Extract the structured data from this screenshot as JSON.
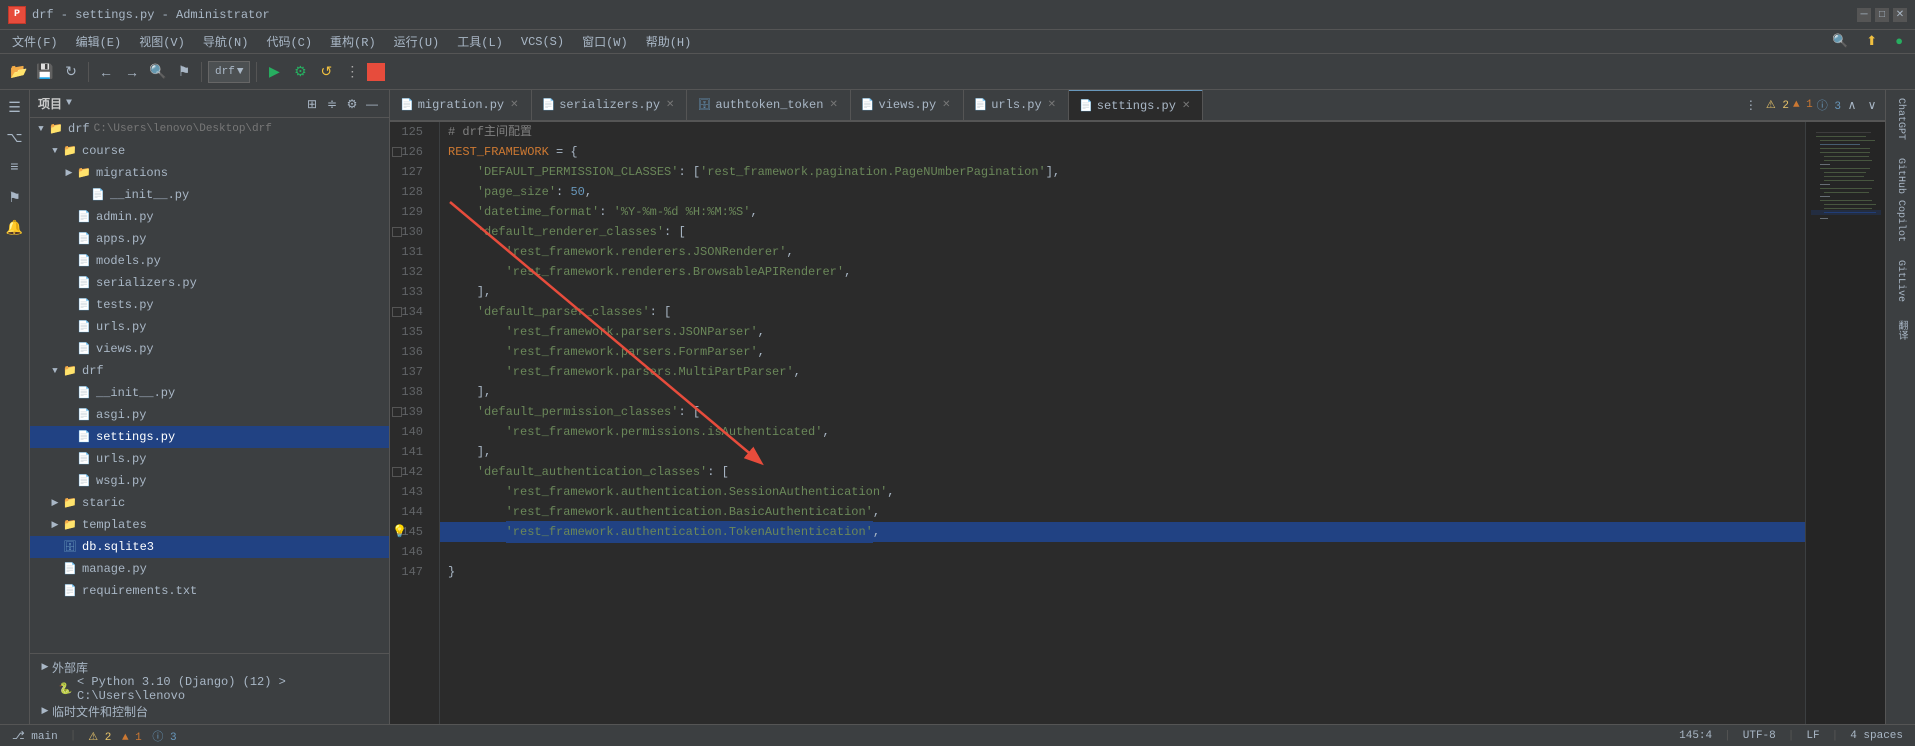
{
  "titlebar": {
    "title": "drf - settings.py - Administrator",
    "logo": "P"
  },
  "menubar": {
    "items": [
      "文件(F)",
      "编辑(E)",
      "视图(V)",
      "导航(N)",
      "代码(C)",
      "重构(R)",
      "运行(U)",
      "工具(L)",
      "VCS(S)",
      "窗口(W)",
      "帮助(H)"
    ]
  },
  "toolbar": {
    "project_name": "drf",
    "run_stop_label": "■"
  },
  "tabs": [
    {
      "label": "migration.py",
      "icon": "📄",
      "active": false
    },
    {
      "label": "serializers.py",
      "icon": "📄",
      "active": false
    },
    {
      "label": "authtoken_token",
      "icon": "🗄",
      "active": false
    },
    {
      "label": "views.py",
      "icon": "📄",
      "active": false
    },
    {
      "label": "urls.py",
      "icon": "📄",
      "active": false
    },
    {
      "label": "settings.py",
      "icon": "📄",
      "active": true
    }
  ],
  "filetree": {
    "project_name": "drf",
    "project_path": "C:\\Users\\lenovo\\Desktop\\drf",
    "items": [
      {
        "id": "drf-root",
        "label": "drf",
        "type": "folder",
        "level": 0,
        "expanded": true,
        "path": "C:\\Users\\lenovo\\Desktop\\drf"
      },
      {
        "id": "course",
        "label": "course",
        "type": "folder",
        "level": 1,
        "expanded": true
      },
      {
        "id": "migrations",
        "label": "migrations",
        "type": "folder",
        "level": 2,
        "expanded": false
      },
      {
        "id": "init1",
        "label": "__init__.py",
        "type": "py",
        "level": 3
      },
      {
        "id": "admin",
        "label": "admin.py",
        "type": "py",
        "level": 2
      },
      {
        "id": "apps",
        "label": "apps.py",
        "type": "py",
        "level": 2
      },
      {
        "id": "models",
        "label": "models.py",
        "type": "py",
        "level": 2
      },
      {
        "id": "serializers",
        "label": "serializers.py",
        "type": "py",
        "level": 2
      },
      {
        "id": "tests",
        "label": "tests.py",
        "type": "py",
        "level": 2
      },
      {
        "id": "urls-course",
        "label": "urls.py",
        "type": "py",
        "level": 2
      },
      {
        "id": "views-course",
        "label": "views.py",
        "type": "py",
        "level": 2
      },
      {
        "id": "drf-inner",
        "label": "drf",
        "type": "folder",
        "level": 1,
        "expanded": true
      },
      {
        "id": "init2",
        "label": "__init__.py",
        "type": "py",
        "level": 2
      },
      {
        "id": "asgi",
        "label": "asgi.py",
        "type": "py",
        "level": 2
      },
      {
        "id": "settings",
        "label": "settings.py",
        "type": "py",
        "level": 2,
        "selected": true
      },
      {
        "id": "urls-drf",
        "label": "urls.py",
        "type": "py",
        "level": 2
      },
      {
        "id": "wsgi",
        "label": "wsgi.py",
        "type": "py",
        "level": 2
      },
      {
        "id": "staric",
        "label": "staric",
        "type": "folder",
        "level": 1,
        "expanded": false
      },
      {
        "id": "templates",
        "label": "templates",
        "type": "folder",
        "level": 1,
        "expanded": false
      },
      {
        "id": "db-sqlite",
        "label": "db.sqlite3",
        "type": "db",
        "level": 1,
        "selected": true
      },
      {
        "id": "manage",
        "label": "manage.py",
        "type": "py",
        "level": 1
      },
      {
        "id": "requirements",
        "label": "requirements.txt",
        "type": "txt",
        "level": 1
      }
    ],
    "bottom": [
      {
        "label": "外部库",
        "type": "section"
      },
      {
        "label": "< Python 3.10 (Django) (12) > C:\\Users\\lenovo",
        "type": "item"
      },
      {
        "label": "临时文件和控制台",
        "type": "section"
      }
    ]
  },
  "editor": {
    "filename": "settings.py",
    "warning_count": 2,
    "alert_count": 1,
    "info_count": 3,
    "lines": [
      {
        "num": 125,
        "content": "# drf主间配置",
        "type": "comment"
      },
      {
        "num": 126,
        "content": "REST_FRAMEWORK = {",
        "type": "code",
        "has_fold": true
      },
      {
        "num": 127,
        "content": "    'DEFAULT_PERMISSION_CLASSES': ['rest_framework.pagination.PageNUmberPagination'],",
        "type": "code"
      },
      {
        "num": 128,
        "content": "    'page_size': 50,",
        "type": "code"
      },
      {
        "num": 129,
        "content": "    'datetime_format': '%Y-%m-%d %H:%M:%S',",
        "type": "code"
      },
      {
        "num": 130,
        "content": "    'default_renderer_classes': [",
        "type": "code",
        "has_fold": true
      },
      {
        "num": 131,
        "content": "        'rest_framework.renderers.JSONRenderer',",
        "type": "code"
      },
      {
        "num": 132,
        "content": "        'rest_framework.renderers.BrowsableAPIRenderer',",
        "type": "code"
      },
      {
        "num": 133,
        "content": "    ],",
        "type": "code"
      },
      {
        "num": 134,
        "content": "    'default_parser_classes': [",
        "type": "code",
        "has_fold": true
      },
      {
        "num": 135,
        "content": "        'rest_framework.parsers.JSONParser',",
        "type": "code"
      },
      {
        "num": 136,
        "content": "        'rest_framework.parsers.FormParser',",
        "type": "code"
      },
      {
        "num": 137,
        "content": "        'rest_framework.parsers.MultiPartParser',",
        "type": "code"
      },
      {
        "num": 138,
        "content": "    ],",
        "type": "code"
      },
      {
        "num": 139,
        "content": "    'default_permission_classes': [",
        "type": "code",
        "has_fold": true
      },
      {
        "num": 140,
        "content": "        'rest_framework.permissions.isAuthenticated',",
        "type": "code"
      },
      {
        "num": 141,
        "content": "    ],",
        "type": "code"
      },
      {
        "num": 142,
        "content": "    'default_authentication_classes': [",
        "type": "code",
        "has_fold": true
      },
      {
        "num": 143,
        "content": "        'rest_framework.authentication.SessionAuthentication',",
        "type": "code"
      },
      {
        "num": 144,
        "content": "        'rest_framework.authentication.BasicAuthentication',",
        "type": "code"
      },
      {
        "num": 145,
        "content": "        'rest_framework.authentication.TokenAuthentication',",
        "type": "code",
        "selected": true,
        "has_bulb": true
      },
      {
        "num": 146,
        "content": "",
        "type": "code"
      },
      {
        "num": 147,
        "content": "}",
        "type": "code"
      }
    ]
  },
  "statusbar": {
    "line_col": "145:4",
    "encoding": "UTF-8",
    "line_separator": "LF",
    "indent": "4 spaces",
    "git": "main",
    "warnings": "⚠ 2  ▲ 1  ⓘ 3"
  },
  "right_panels": [
    "ChatGPT",
    "GitHub Copilot",
    "GitLive",
    "翻译"
  ],
  "icons": {
    "search": "🔍",
    "folder": "📁",
    "file_py": "🐍",
    "gear": "⚙",
    "arrow_down": "▼",
    "arrow_right": "▶",
    "close": "✕",
    "bulb": "💡"
  }
}
